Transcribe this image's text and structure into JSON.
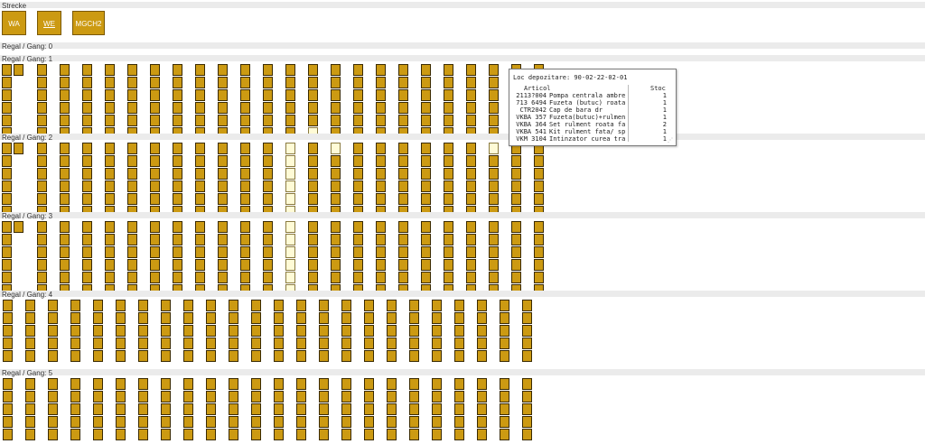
{
  "strecke": {
    "label": "Strecke",
    "buttons": [
      {
        "label": "WA",
        "underline": false
      },
      {
        "label": "WE",
        "underline": true
      },
      {
        "label": "MGCH2",
        "underline": false
      }
    ]
  },
  "colors": {
    "occupied": "#cc9a12",
    "empty": "#fffbd6",
    "band": "#ebebeb"
  },
  "aisles": [
    {
      "label": "Regal / Gang: 0",
      "racks": []
    },
    {
      "label": "Regal / Gang: 1",
      "racks": [
        {
          "levels": 6,
          "empty": []
        },
        {
          "levels": 1,
          "empty": []
        },
        {
          "levels": 6,
          "empty": []
        },
        {
          "levels": 6,
          "empty": []
        },
        {
          "levels": 6,
          "empty": []
        },
        {
          "levels": 6,
          "empty": []
        },
        {
          "levels": 6,
          "empty": []
        },
        {
          "levels": 6,
          "empty": []
        },
        {
          "levels": 6,
          "empty": []
        },
        {
          "levels": 6,
          "empty": []
        },
        {
          "levels": 6,
          "empty": []
        },
        {
          "levels": 6,
          "empty": []
        },
        {
          "levels": 6,
          "empty": []
        },
        {
          "levels": 6,
          "empty": []
        },
        {
          "levels": 6,
          "empty": [
            5
          ]
        },
        {
          "levels": 6,
          "empty": []
        },
        {
          "levels": 6,
          "empty": []
        },
        {
          "levels": 6,
          "empty": []
        },
        {
          "levels": 6,
          "empty": []
        },
        {
          "levels": 6,
          "empty": []
        },
        {
          "levels": 6,
          "empty": []
        },
        {
          "levels": 6,
          "empty": []
        },
        {
          "levels": 6,
          "empty": []
        },
        {
          "levels": 6,
          "empty": []
        },
        {
          "levels": 6,
          "empty": []
        }
      ]
    },
    {
      "label": "Regal / Gang: 2",
      "racks": [
        {
          "levels": 6,
          "empty": []
        },
        {
          "levels": 1,
          "empty": []
        },
        {
          "levels": 6,
          "empty": []
        },
        {
          "levels": 6,
          "empty": []
        },
        {
          "levels": 6,
          "empty": []
        },
        {
          "levels": 6,
          "empty": []
        },
        {
          "levels": 6,
          "empty": []
        },
        {
          "levels": 6,
          "empty": []
        },
        {
          "levels": 6,
          "empty": []
        },
        {
          "levels": 6,
          "empty": []
        },
        {
          "levels": 6,
          "empty": []
        },
        {
          "levels": 6,
          "empty": []
        },
        {
          "levels": 6,
          "empty": []
        },
        {
          "levels": 6,
          "empty": [
            0,
            1,
            2,
            3,
            4,
            5
          ]
        },
        {
          "levels": 6,
          "empty": []
        },
        {
          "levels": 6,
          "empty": [
            0
          ]
        },
        {
          "levels": 6,
          "empty": []
        },
        {
          "levels": 6,
          "empty": []
        },
        {
          "levels": 6,
          "empty": []
        },
        {
          "levels": 6,
          "empty": []
        },
        {
          "levels": 6,
          "empty": []
        },
        {
          "levels": 6,
          "empty": []
        },
        {
          "levels": 6,
          "empty": [
            0
          ]
        },
        {
          "levels": 6,
          "empty": []
        },
        {
          "levels": 6,
          "empty": []
        }
      ]
    },
    {
      "label": "Regal / Gang: 3",
      "racks": [
        {
          "levels": 6,
          "empty": []
        },
        {
          "levels": 1,
          "empty": []
        },
        {
          "levels": 6,
          "empty": []
        },
        {
          "levels": 6,
          "empty": []
        },
        {
          "levels": 6,
          "empty": []
        },
        {
          "levels": 6,
          "empty": []
        },
        {
          "levels": 6,
          "empty": []
        },
        {
          "levels": 6,
          "empty": []
        },
        {
          "levels": 6,
          "empty": []
        },
        {
          "levels": 6,
          "empty": []
        },
        {
          "levels": 6,
          "empty": []
        },
        {
          "levels": 6,
          "empty": []
        },
        {
          "levels": 6,
          "empty": []
        },
        {
          "levels": 6,
          "empty": [
            0,
            1,
            2,
            3,
            4,
            5
          ]
        },
        {
          "levels": 6,
          "empty": []
        },
        {
          "levels": 6,
          "empty": []
        },
        {
          "levels": 6,
          "empty": []
        },
        {
          "levels": 6,
          "empty": []
        },
        {
          "levels": 6,
          "empty": []
        },
        {
          "levels": 6,
          "empty": []
        },
        {
          "levels": 6,
          "empty": []
        },
        {
          "levels": 6,
          "empty": []
        },
        {
          "levels": 6,
          "empty": []
        },
        {
          "levels": 6,
          "empty": []
        },
        {
          "levels": 6,
          "empty": []
        }
      ]
    },
    {
      "label": "Regal / Gang: 4",
      "racks": [
        {
          "levels": 5,
          "empty": []
        },
        {
          "levels": 5,
          "empty": []
        },
        {
          "levels": 5,
          "empty": []
        },
        {
          "levels": 5,
          "empty": []
        },
        {
          "levels": 5,
          "empty": []
        },
        {
          "levels": 5,
          "empty": []
        },
        {
          "levels": 5,
          "empty": []
        },
        {
          "levels": 5,
          "empty": []
        },
        {
          "levels": 5,
          "empty": []
        },
        {
          "levels": 5,
          "empty": []
        },
        {
          "levels": 5,
          "empty": []
        },
        {
          "levels": 5,
          "empty": []
        },
        {
          "levels": 5,
          "empty": []
        },
        {
          "levels": 5,
          "empty": []
        },
        {
          "levels": 5,
          "empty": []
        },
        {
          "levels": 5,
          "empty": []
        },
        {
          "levels": 5,
          "empty": []
        },
        {
          "levels": 5,
          "empty": []
        },
        {
          "levels": 5,
          "empty": []
        },
        {
          "levels": 5,
          "empty": []
        },
        {
          "levels": 5,
          "empty": []
        },
        {
          "levels": 5,
          "empty": []
        },
        {
          "levels": 5,
          "empty": []
        },
        {
          "levels": 5,
          "empty": []
        }
      ]
    },
    {
      "label": "Regal / Gang: 5",
      "racks": [
        {
          "levels": 5,
          "empty": []
        },
        {
          "levels": 5,
          "empty": []
        },
        {
          "levels": 5,
          "empty": []
        },
        {
          "levels": 5,
          "empty": []
        },
        {
          "levels": 5,
          "empty": []
        },
        {
          "levels": 5,
          "empty": []
        },
        {
          "levels": 5,
          "empty": []
        },
        {
          "levels": 5,
          "empty": []
        },
        {
          "levels": 5,
          "empty": []
        },
        {
          "levels": 5,
          "empty": []
        },
        {
          "levels": 5,
          "empty": []
        },
        {
          "levels": 5,
          "empty": []
        },
        {
          "levels": 5,
          "empty": []
        },
        {
          "levels": 5,
          "empty": []
        },
        {
          "levels": 5,
          "empty": []
        },
        {
          "levels": 5,
          "empty": []
        },
        {
          "levels": 5,
          "empty": []
        },
        {
          "levels": 5,
          "empty": []
        },
        {
          "levels": 5,
          "empty": []
        },
        {
          "levels": 5,
          "empty": []
        },
        {
          "levels": 5,
          "empty": []
        },
        {
          "levels": 5,
          "empty": []
        },
        {
          "levels": 5,
          "empty": []
        },
        {
          "levels": 5,
          "empty": []
        }
      ]
    }
  ],
  "tooltip": {
    "title": "Loc depozitare: 90-02-22-02-01",
    "col_article": "Articol",
    "col_stock": "Stoc",
    "rows": [
      {
        "code": "2113?004",
        "name": "Pompa centrala ambre",
        "stock": "1"
      },
      {
        "code": "713 6494",
        "name": "Fuzeta (butuc) roata",
        "stock": "1"
      },
      {
        "code": "CTR2042",
        "name": "Cap de bara dr",
        "stock": "1"
      },
      {
        "code": "VKBA 357",
        "name": "Fuzeta(butuc)+rulmen",
        "stock": "1"
      },
      {
        "code": "VKBA 364",
        "name": "Set rulment roata fa",
        "stock": "2"
      },
      {
        "code": "VKBA 541",
        "name": "Kit rulment fata/ sp",
        "stock": "1"
      },
      {
        "code": "VKM 3104",
        "name": "Intinzator curea tra",
        "stock": "1"
      }
    ]
  }
}
